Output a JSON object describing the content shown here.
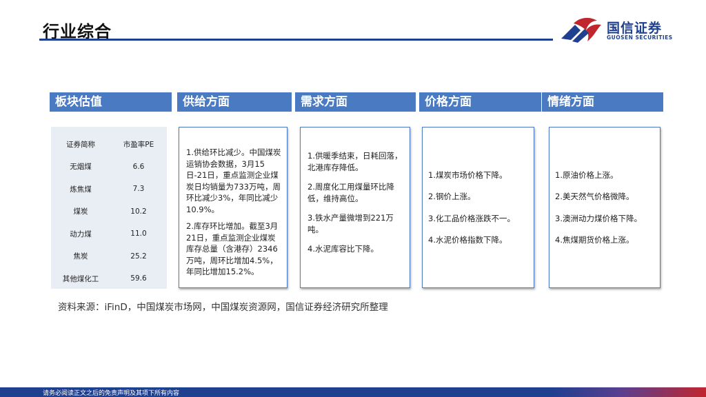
{
  "page": {
    "title": "行业综合"
  },
  "logo": {
    "name": "国信证券",
    "sub": "GUOSEN SECURITIES"
  },
  "columns": [
    {
      "header": "板块估值"
    },
    {
      "header": "供给方面",
      "items": [
        "1.供给环比减少。中国煤炭运销协会数据，3月15日-21日，重点监测企业煤炭日均销量为733万吨，周环比减少3%，年同比减少10.9%。",
        "2.库存环比增加。截至3月21日，重点监测企业煤炭库存总量（含港存）2346万吨，周环比增加4.5%，年同比增加15.2%。"
      ]
    },
    {
      "header": "需求方面",
      "items": [
        "1.供暖季结束，日耗回落，北港库存降低。",
        "2.周度化工用煤量环比降低，维持高位。",
        "3.铁水产量微增到221万吨。",
        "4.水泥库容比下降。"
      ]
    },
    {
      "header": "价格方面",
      "items": [
        "1.煤炭市场价格下降。",
        "2.钢价上涨。",
        "3.化工品价格涨跌不一。",
        "4.水泥价格指数下降。"
      ]
    },
    {
      "header": "情绪方面",
      "items": [
        "1.原油价格上涨。",
        "2.美天然气价格微降。",
        "3.澳洲动力煤价格下降。",
        "4.焦煤期货价格上涨。"
      ]
    }
  ],
  "valuation": {
    "headers": [
      "证券简称",
      "市盈率PE"
    ],
    "rows": [
      [
        "无烟煤",
        "6.6"
      ],
      [
        "炼焦煤",
        "7.3"
      ],
      [
        "煤炭",
        "10.2"
      ],
      [
        "动力煤",
        "11.0"
      ],
      [
        "焦炭",
        "25.2"
      ],
      [
        "其他煤化工",
        "59.6"
      ]
    ]
  },
  "source": "资料来源：iFinD，中国煤炭市场网，中国煤炭资源网，国信证券经济研究所整理",
  "footer": "请务必阅读正文之后的免责声明及其项下所有内容",
  "colors": {
    "header_bg": "#4a7ac2",
    "title_rule": "#1f3f8f",
    "panel_bg": "#e9edf4",
    "logo_red": "#c0262e",
    "logo_blue": "#1f3f8f"
  }
}
